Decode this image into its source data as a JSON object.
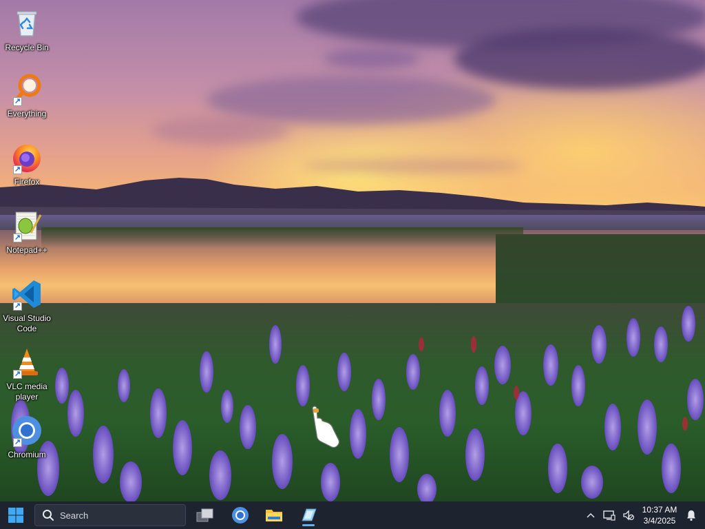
{
  "desktop": {
    "icons": [
      {
        "label": "Recycle Bin",
        "icon": "recycle-bin-icon"
      },
      {
        "label": "Everything",
        "icon": "everything-search-icon"
      },
      {
        "label": "Firefox",
        "icon": "firefox-icon"
      },
      {
        "label": "Notepad++",
        "icon": "notepad-plus-plus-icon"
      },
      {
        "label": "Visual Studio Code",
        "icon": "vscode-icon"
      },
      {
        "label": "VLC media player",
        "icon": "vlc-icon"
      },
      {
        "label": "Chromium",
        "icon": "chromium-icon"
      }
    ]
  },
  "taskbar": {
    "search_placeholder": "Search",
    "pinned": [
      {
        "name": "task-view",
        "icon": "task-view-icon"
      },
      {
        "name": "chromium",
        "icon": "chromium-icon"
      },
      {
        "name": "file-explorer",
        "icon": "folder-icon"
      },
      {
        "name": "app-window",
        "icon": "app-window-icon",
        "active": true
      }
    ],
    "tray": {
      "time": "10:37 AM",
      "date": "3/4/2025"
    }
  },
  "colors": {
    "taskbar_bg": "#1e2330",
    "accent": "#5fb2f2"
  }
}
